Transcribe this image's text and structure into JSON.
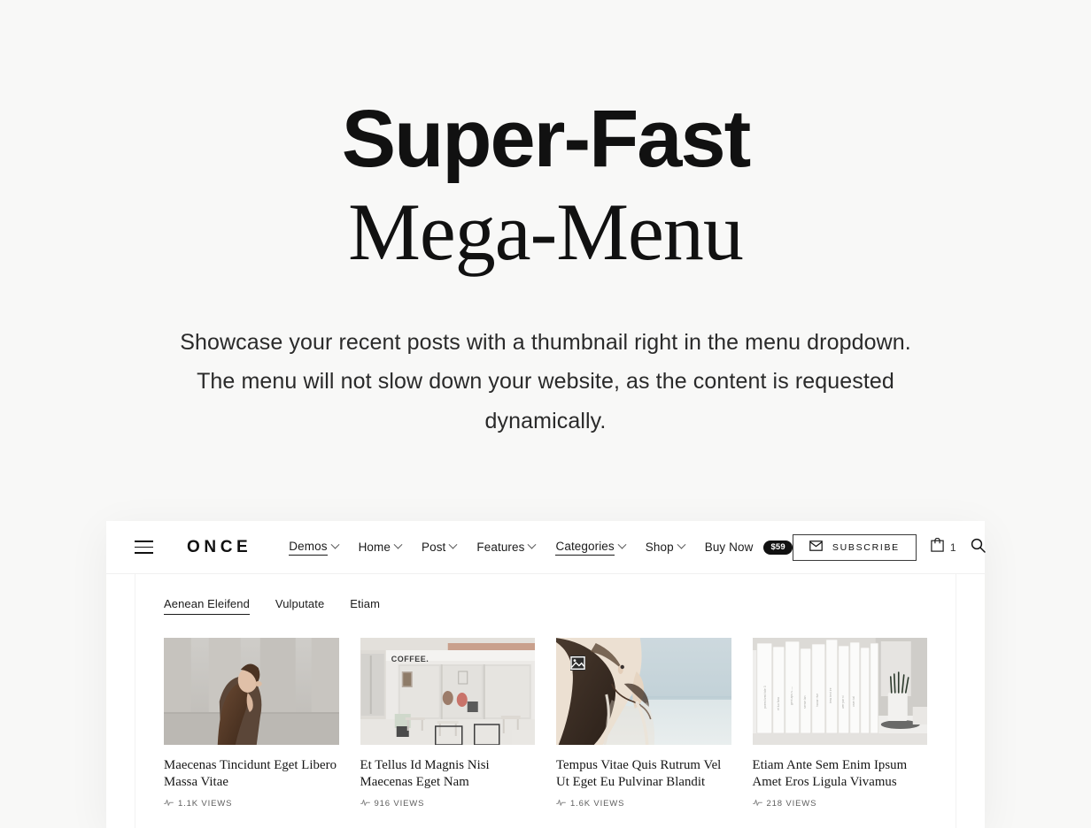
{
  "hero": {
    "title_line1": "Super-Fast",
    "title_line2": "Mega-Menu",
    "subtitle": "Showcase your recent posts with a thumbnail right in the menu dropdown. The menu will not slow down your website, as the content is requested dynamically."
  },
  "navbar": {
    "menu_icon": "hamburger-icon",
    "brand": "ONCE",
    "links": [
      {
        "label": "Demos",
        "has_caret": true,
        "underlined": true
      },
      {
        "label": "Home",
        "has_caret": true,
        "underlined": false
      },
      {
        "label": "Post",
        "has_caret": true,
        "underlined": false
      },
      {
        "label": "Features",
        "has_caret": true,
        "underlined": false
      },
      {
        "label": "Categories",
        "has_caret": true,
        "underlined": true
      },
      {
        "label": "Shop",
        "has_caret": true,
        "underlined": false
      },
      {
        "label": "Buy Now",
        "has_caret": false,
        "underlined": false,
        "badge": "$59"
      }
    ],
    "subscribe_label": "SUBSCRIBE",
    "subscribe_icon": "envelope-icon",
    "cart_icon": "shopping-bag-icon",
    "cart_count": "1",
    "search_icon": "search-icon"
  },
  "megamenu": {
    "tabs": [
      {
        "label": "Aenean Eleifend",
        "active": true
      },
      {
        "label": "Vulputate",
        "active": false
      },
      {
        "label": "Etiam",
        "active": false
      }
    ],
    "posts": [
      {
        "title": "Maecenas Tincidunt Eget Libero Massa Vitae",
        "views": "1.1K VIEWS",
        "views_icon": "activity-pulse-icon",
        "image_alt": "woman-against-concrete-wall",
        "broken_image": false
      },
      {
        "title": "Et Tellus Id Magnis Nisi Maecenas Eget Nam",
        "views": "916 VIEWS",
        "views_icon": "activity-pulse-icon",
        "image_alt": "white-coffee-shop-storefront",
        "broken_image": false
      },
      {
        "title": "Tempus Vitae Quis Rutrum Vel Ut Eget Eu Pulvinar Blandit",
        "views": "1.6K VIEWS",
        "views_icon": "activity-pulse-icon",
        "image_alt": "woman-back-at-beach",
        "broken_image": true
      },
      {
        "title": "Etiam Ante Sem Enim Ipsum Amet Eros Ligula Vivamus",
        "views": "218 VIEWS",
        "views_icon": "activity-pulse-icon",
        "image_alt": "white-books-on-shelf",
        "broken_image": false
      }
    ]
  },
  "colors": {
    "page_background": "#f8f8f7",
    "card_background": "#ffffff",
    "text_primary": "#111111",
    "badge_background": "#111111",
    "badge_text": "#ffffff"
  }
}
